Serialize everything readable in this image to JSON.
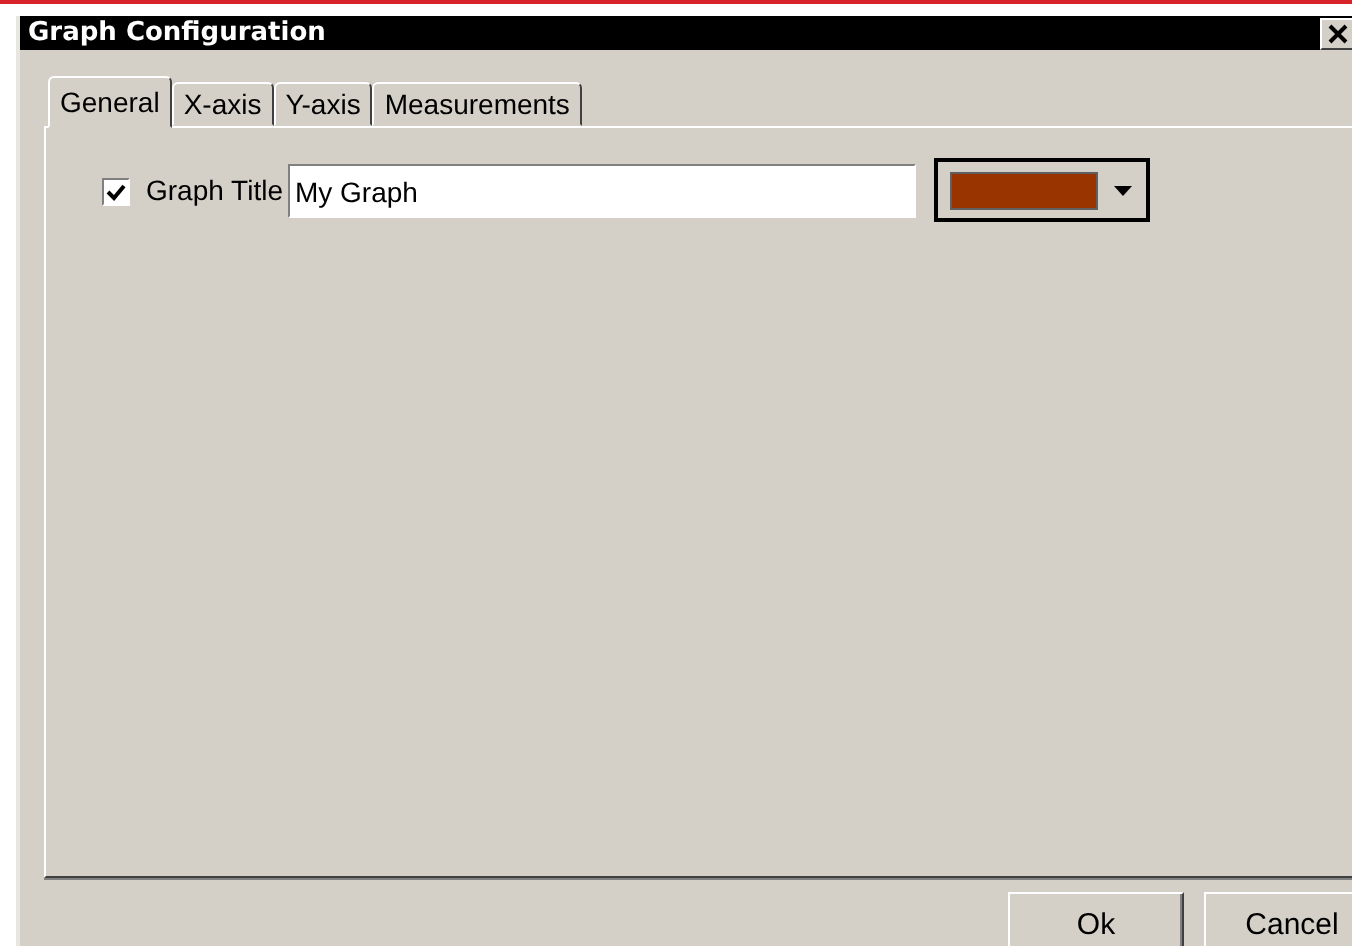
{
  "window": {
    "title": "Graph Configuration"
  },
  "tabs": [
    {
      "label": "General",
      "selected": true
    },
    {
      "label": "X-axis",
      "selected": false
    },
    {
      "label": "Y-axis",
      "selected": false
    },
    {
      "label": "Measurements",
      "selected": false
    }
  ],
  "graph_title": {
    "checked": true,
    "label": "Graph Title",
    "value": "My Graph",
    "color": "#993300"
  },
  "buttons": [
    {
      "label": "Ok"
    },
    {
      "label": "Cancel"
    }
  ]
}
